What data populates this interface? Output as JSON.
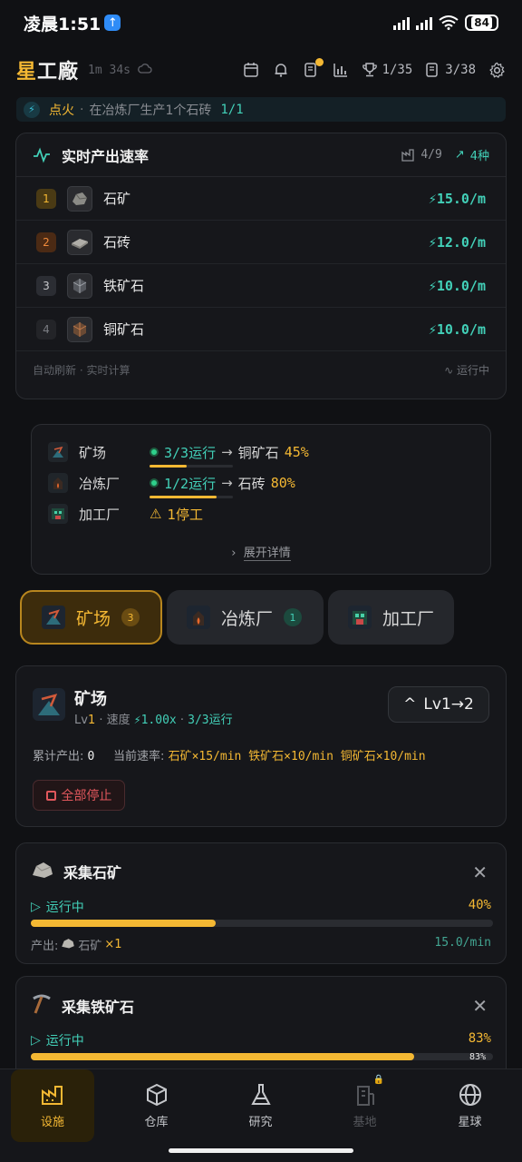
{
  "status_bar": {
    "time": "凌晨1:51",
    "battery": "84"
  },
  "header": {
    "brand_a": "星",
    "brand_b": "工廠",
    "runtime": "1m 34s",
    "trophies": "1/35",
    "quests": "3/38"
  },
  "quest": {
    "name": "点火",
    "desc": "在冶炼厂生产1个石砖",
    "progress": "1/1"
  },
  "rates": {
    "title": "实时产出速率",
    "count": "4/9",
    "trend": "4种",
    "items": [
      {
        "rank": "1",
        "name": "石矿",
        "rate": "15.0/m",
        "icon": "stone-ore-icon"
      },
      {
        "rank": "2",
        "name": "石砖",
        "rate": "12.0/m",
        "icon": "stone-brick-icon"
      },
      {
        "rank": "3",
        "name": "铁矿石",
        "rate": "10.0/m",
        "icon": "iron-ore-icon"
      },
      {
        "rank": "4",
        "name": "铜矿石",
        "rate": "10.0/m",
        "icon": "copper-ore-icon"
      }
    ],
    "footer_left": "自动刷新 · 实时计算",
    "footer_right": "运行中"
  },
  "summary": {
    "rows": [
      {
        "name": "矿场",
        "status": "3/3运行",
        "target": "铜矿石",
        "pct": "45%",
        "progress": 0.45
      },
      {
        "name": "冶炼厂",
        "status": "1/2运行",
        "target": "石砖",
        "pct": "80%",
        "progress": 0.8
      },
      {
        "name": "加工厂",
        "status": "1停工"
      }
    ],
    "expand": "展开详情"
  },
  "tabs": [
    {
      "label": "矿场",
      "badge": "3"
    },
    {
      "label": "冶炼厂",
      "badge": "1"
    },
    {
      "label": "加工厂"
    }
  ],
  "facility": {
    "title": "矿场",
    "level_prefix": "Lv",
    "level": "1",
    "speed_label": "速度",
    "speed": "⚡1.00x",
    "running": "3/3运行",
    "upgrade": "Lv1→2",
    "total_label": "累计产出:",
    "total": "0",
    "rate_label": "当前速率:",
    "rate": "石矿×15/min 铁矿石×10/min 铜矿石×10/min",
    "stop": "全部停止"
  },
  "tasks": [
    {
      "title": "采集石矿",
      "status": "运行中",
      "pct": "40%",
      "progress": 0.4,
      "output_label": "产出:",
      "output_item": "石矿",
      "output_qty": "×1",
      "rate": "15.0/min"
    },
    {
      "title": "采集铁矿石",
      "status": "运行中",
      "pct": "83%",
      "progress": 0.83,
      "bar_label": "83%"
    }
  ],
  "nav": [
    {
      "label": "设施"
    },
    {
      "label": "仓库"
    },
    {
      "label": "研究"
    },
    {
      "label": "基地"
    },
    {
      "label": "星球"
    }
  ],
  "colors": {
    "accent": "#f4b833",
    "teal": "#42d0b8",
    "danger": "#e0575c",
    "bg": "#101114"
  }
}
